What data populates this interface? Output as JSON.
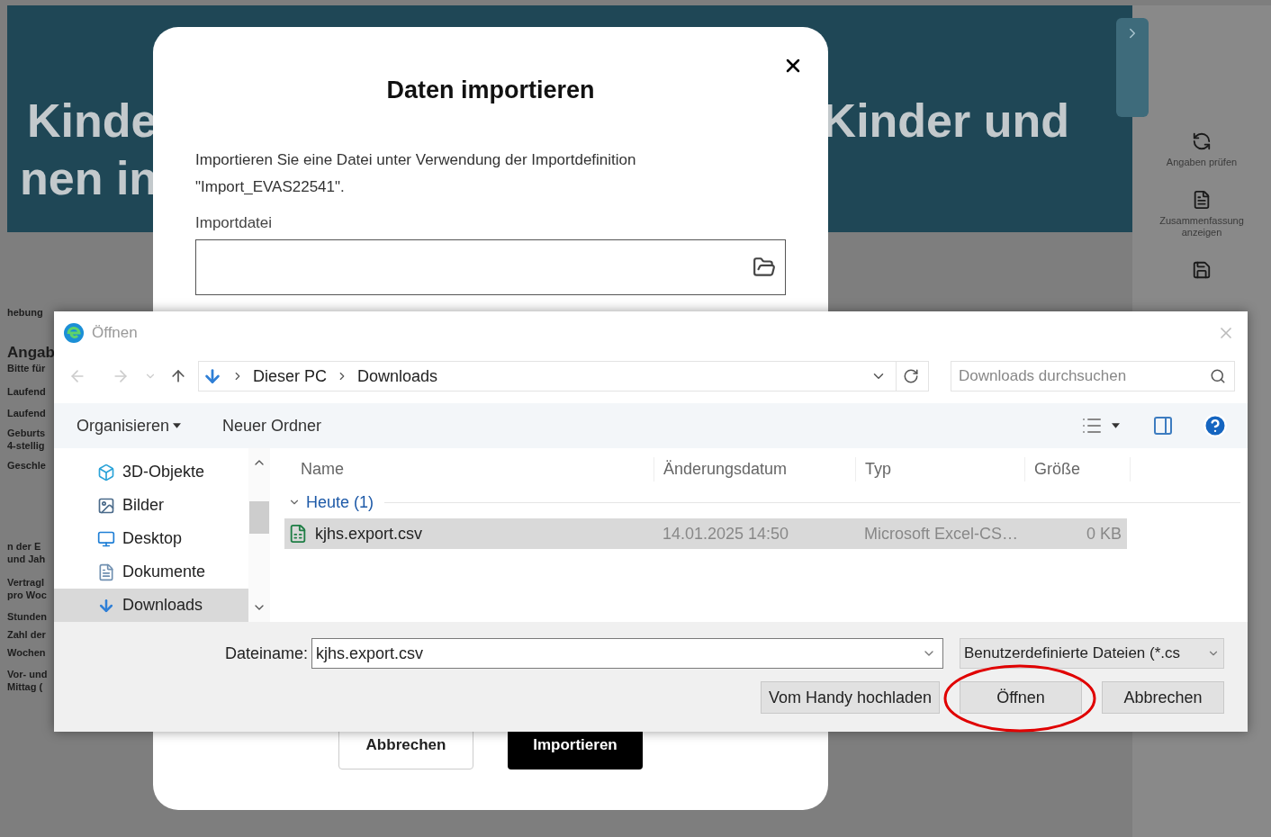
{
  "background": {
    "header_left": [
      "Kinde",
      "nen in"
    ],
    "header_right": "Kinder und",
    "left_fragments": [
      [
        "hebung"
      ],
      [
        "Angab",
        "Bitte für"
      ],
      [
        "Laufend"
      ],
      [
        "Laufend"
      ],
      [
        "Geburts",
        "4-stellig"
      ],
      [
        "Geschle"
      ],
      [
        "n der E",
        "und Jah"
      ],
      [
        "Vertragl",
        "pro Woc"
      ],
      [
        "Stunden"
      ],
      [
        "Zahl der"
      ],
      [
        "Wochen"
      ],
      [
        "Vor- und",
        "Mittag ("
      ]
    ],
    "sidebar_actions": [
      {
        "kind": "check",
        "label": "Angaben prüfen"
      },
      {
        "kind": "summary",
        "label": "Zusammenfassung anzeigen"
      },
      {
        "kind": "save"
      }
    ]
  },
  "import_dialog": {
    "title": "Daten importieren",
    "description": "Importieren Sie eine Datei unter Verwendung der Importdefinition \"Import_EVAS22541\".",
    "field_label": "Importdatei",
    "buttons": [
      {
        "label": "Abbrechen",
        "primary": false
      },
      {
        "label": "Importieren",
        "primary": true
      }
    ]
  },
  "file_dialog": {
    "title": "Öffnen",
    "path": [
      "Dieser PC",
      "Downloads"
    ],
    "search": {
      "placeholder": "Downloads durchsuchen"
    },
    "toolbar": [
      "Organisieren",
      "Neuer Ordner"
    ],
    "nav_items": [
      {
        "label": "3D-Objekte",
        "kind": "objects",
        "selected": false
      },
      {
        "label": "Bilder",
        "kind": "pictures",
        "selected": false
      },
      {
        "label": "Desktop",
        "kind": "desktop",
        "selected": false
      },
      {
        "label": "Dokumente",
        "kind": "documents",
        "selected": false
      },
      {
        "label": "Downloads",
        "kind": "downloads",
        "selected": true
      }
    ],
    "columns": [
      "Name",
      "Änderungsdatum",
      "Typ",
      "Größe"
    ],
    "groups": [
      {
        "label": "Heute (1)",
        "expanded": true,
        "rows": [
          {
            "name": "kjhs.export.csv",
            "date": "14.01.2025 14:50",
            "type": "Microsoft Excel-CS…",
            "size": "0 KB",
            "selected": true
          }
        ]
      }
    ],
    "filename_label": "Dateiname:",
    "filename": "kjhs.export.csv",
    "filter": "Benutzerdefinierte Dateien (*.cs",
    "buttons": [
      {
        "label": "Vom Handy hochladen",
        "highlighted": false
      },
      {
        "label": "Öffnen",
        "highlighted": true
      },
      {
        "label": "Abbrechen",
        "highlighted": false
      }
    ]
  }
}
